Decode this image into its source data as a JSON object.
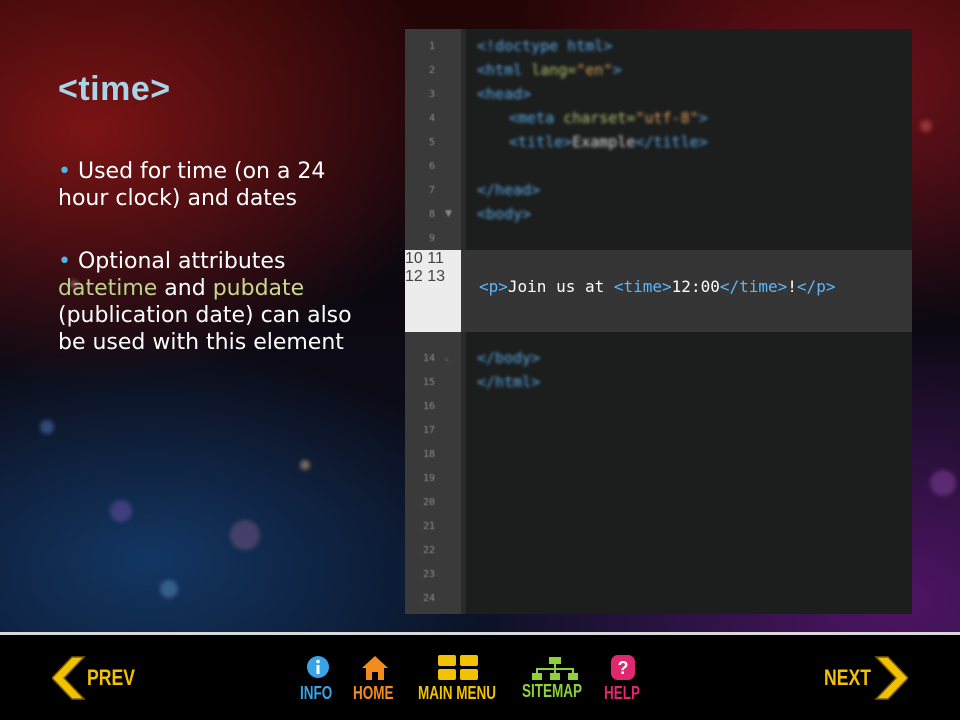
{
  "slide": {
    "title": "<time>",
    "bullets": [
      {
        "text": "Used for time (on a 24 hour clock) and dates"
      },
      {
        "pre": "Optional attributes ",
        "hl1": "datetime",
        "mid": " and ",
        "hl2": "pubdate",
        "post": " (publication date) can also be used with this element"
      }
    ]
  },
  "code": {
    "line_numbers": [
      "1",
      "2",
      "3",
      "4",
      "5",
      "6",
      "7",
      "8",
      "9",
      "10",
      "11",
      "12",
      "13",
      "14",
      "15",
      "16",
      "17",
      "18",
      "19",
      "20",
      "21",
      "22",
      "23",
      "24"
    ],
    "lines": {
      "l1": "<!doctype html>",
      "l2_tag": "<html ",
      "l2_attr": "lang=",
      "l2_str": "\"en\"",
      "l2_end": ">",
      "l3": "<head>",
      "l4_tag": "<meta ",
      "l4_attr": "charset=",
      "l4_str": "\"utf-8\"",
      "l4_end": ">",
      "l5_open": "<title>",
      "l5_text": "Example",
      "l5_close": "</title>",
      "l7": "</head>",
      "l8": "<body>",
      "l14": "</body>",
      "l15": "</html>"
    },
    "focus": {
      "p_open": "<p>",
      "text1": "Join us at ",
      "time_open": "<time>",
      "time_value": "12:00",
      "time_close": "</time>",
      "text2": "!",
      "p_close": "</p>"
    }
  },
  "nav": {
    "prev": "PREV",
    "info": "INFO",
    "home": "HOME",
    "main_menu": "MAIN MENU",
    "sitemap": "SITEMAP",
    "help": "HELP",
    "next": "NEXT"
  },
  "colors": {
    "prev_next": "#f2c200",
    "info": "#3aa3e6",
    "home": "#f28c1c",
    "main_menu": "#f2c200",
    "sitemap": "#8ed13a",
    "help": "#e0286e"
  }
}
